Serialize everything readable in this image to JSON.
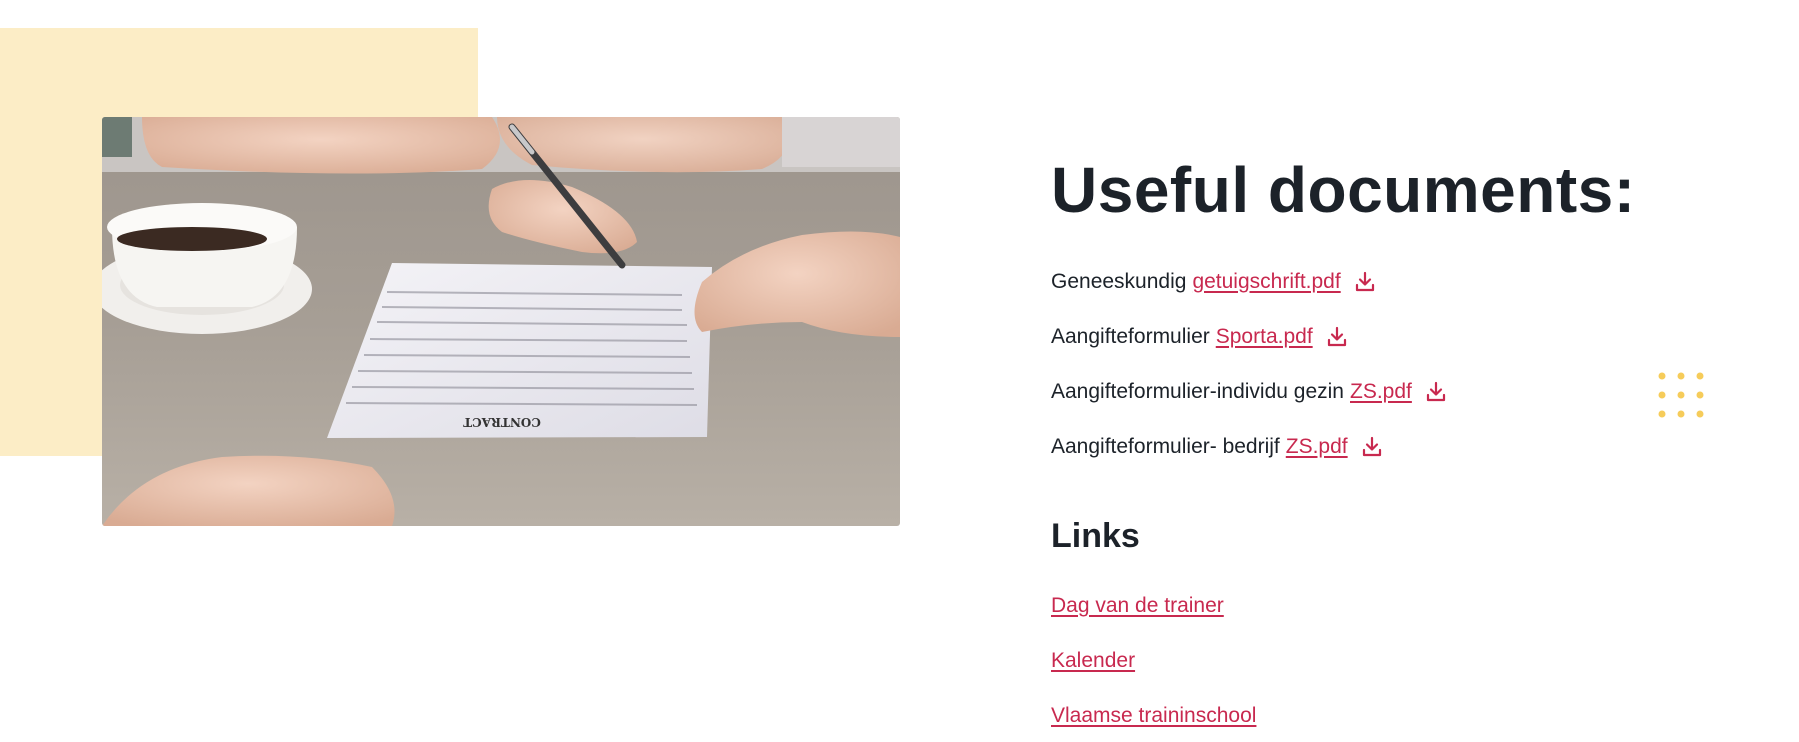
{
  "colors": {
    "accent_block": "#fcedc6",
    "link": "#c8294f",
    "heading": "#1c2229",
    "dots": "#f6cc5a"
  },
  "image": {
    "subject": "two people signing a contract document at a table with a coffee cup",
    "document_heading": "CONTRACT"
  },
  "documents": {
    "title": "Useful documents:",
    "items": [
      {
        "prefix": "Geneeskundig",
        "link": "getuigschrift.pdf",
        "icon": "download-icon"
      },
      {
        "prefix": "Aangifteformulier",
        "link": "Sporta.pdf",
        "icon": "download-icon"
      },
      {
        "prefix": "Aangifteformulier-individu gezin",
        "link": "ZS.pdf",
        "icon": "download-icon"
      },
      {
        "prefix": "Aangifteformulier- bedrijf",
        "link": "ZS.pdf",
        "icon": "download-icon"
      }
    ]
  },
  "links": {
    "title": "Links",
    "items": [
      "Dag van de trainer",
      "Kalender",
      "Vlaamse traininschool"
    ]
  }
}
